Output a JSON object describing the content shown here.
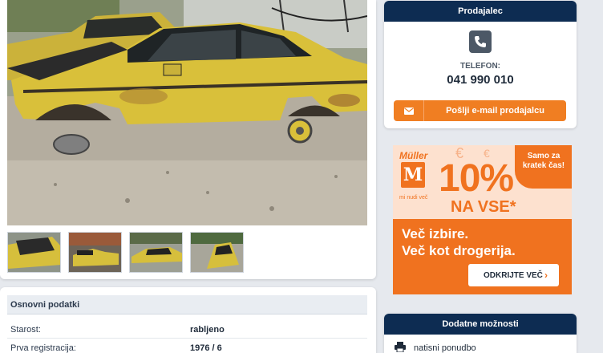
{
  "seller": {
    "header": "Prodajalec",
    "icon": "phone-icon",
    "phone_label": "TELEFON:",
    "phone_number": "041 990 010",
    "email_button": "Pošlji e-mail prodajalcu",
    "email_icon": "envelope-icon"
  },
  "ad": {
    "brand": "Müller",
    "brand_letter": "M",
    "slogan": "mi nudi več",
    "bubble": "Samo za kratek čas!",
    "percent": "10%",
    "vse": "NA VSE*",
    "line1": "Več izbire.",
    "line2": "Več kot drogerija.",
    "cta": "ODKRIJTE VEČ",
    "euro_symbol": "€",
    "accent": "#f0721f"
  },
  "details": {
    "title": "Osnovni podatki",
    "rows": [
      {
        "label": "Starost:",
        "value": "rabljeno"
      },
      {
        "label": "Prva registracija:",
        "value": "1976 / 6"
      }
    ]
  },
  "options": {
    "header": "Dodatne možnosti",
    "items": [
      {
        "label": "natisni ponudbo",
        "icon": "printer-icon"
      }
    ]
  },
  "gallery": {
    "thumbnails": 4
  },
  "colors": {
    "navy": "#0d2c52",
    "orange": "#f07e22",
    "car_yellow": "#d9c03a"
  }
}
